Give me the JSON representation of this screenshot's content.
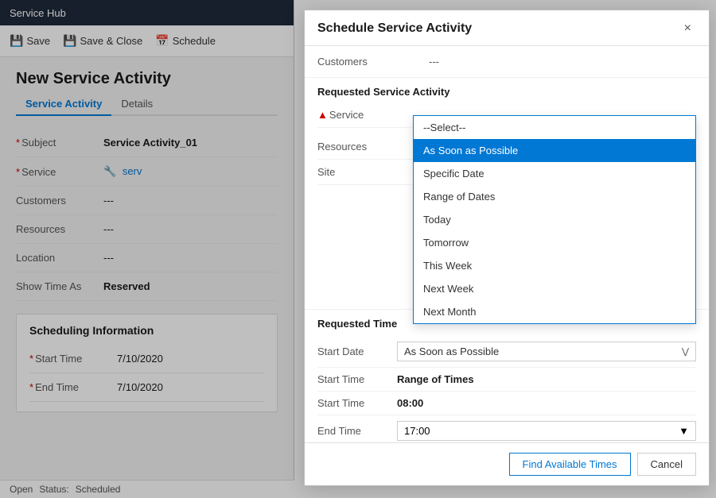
{
  "app": {
    "title": "Service Hub",
    "page_title": "New Service Activity"
  },
  "toolbar": {
    "save_label": "Save",
    "save_close_label": "Save & Close",
    "schedule_label": "Schedule"
  },
  "tabs": {
    "service_activity_label": "Service Activity",
    "details_label": "Details"
  },
  "form": {
    "subject_label": "Subject",
    "subject_value": "Service Activity_01",
    "service_label": "Service",
    "service_value": "serv",
    "customers_label": "Customers",
    "customers_value": "---",
    "resources_label": "Resources",
    "resources_value": "---",
    "location_label": "Location",
    "location_value": "---",
    "show_time_as_label": "Show Time As",
    "show_time_as_value": "Reserved"
  },
  "scheduling": {
    "section_title": "Scheduling Information",
    "start_time_label": "Start Time",
    "start_time_value": "7/10/2020",
    "end_time_label": "End Time",
    "end_time_value": "7/10/2020"
  },
  "statusbar": {
    "status_label": "Open",
    "status_text": "Status:",
    "status_value": "Scheduled"
  },
  "dialog": {
    "title": "Schedule Service Activity",
    "close_label": "×",
    "customers_label": "Customers",
    "customers_value": "---",
    "rsa_section_title": "Requested Service Activity",
    "service_label": "Service",
    "resources_label": "Resources",
    "resources_value": "",
    "site_label": "Site",
    "site_value": "",
    "dropdown": {
      "select_label": "--Select--",
      "options": [
        {
          "value": "select",
          "label": "--Select--"
        },
        {
          "value": "asap",
          "label": "As Soon as Possible",
          "selected": true
        },
        {
          "value": "specific",
          "label": "Specific Date"
        },
        {
          "value": "range",
          "label": "Range of Dates"
        },
        {
          "value": "today",
          "label": "Today"
        },
        {
          "value": "tomorrow",
          "label": "Tomorrow"
        },
        {
          "value": "this_week",
          "label": "This Week"
        },
        {
          "value": "next_week",
          "label": "Next Week"
        },
        {
          "value": "next_month",
          "label": "Next Month"
        }
      ]
    },
    "requested_time": {
      "section_title": "Requested Time",
      "start_date_label": "Start Date",
      "start_date_value": "As Soon as Possible",
      "start_time_section_label": "Start Time",
      "start_time_section_value": "Range of Times",
      "start_time_label": "Start Time",
      "start_time_value": "08:00",
      "end_time_label": "End Time",
      "end_time_value": "17:00"
    },
    "footer": {
      "find_times_label": "Find Available Times",
      "cancel_label": "Cancel"
    }
  }
}
